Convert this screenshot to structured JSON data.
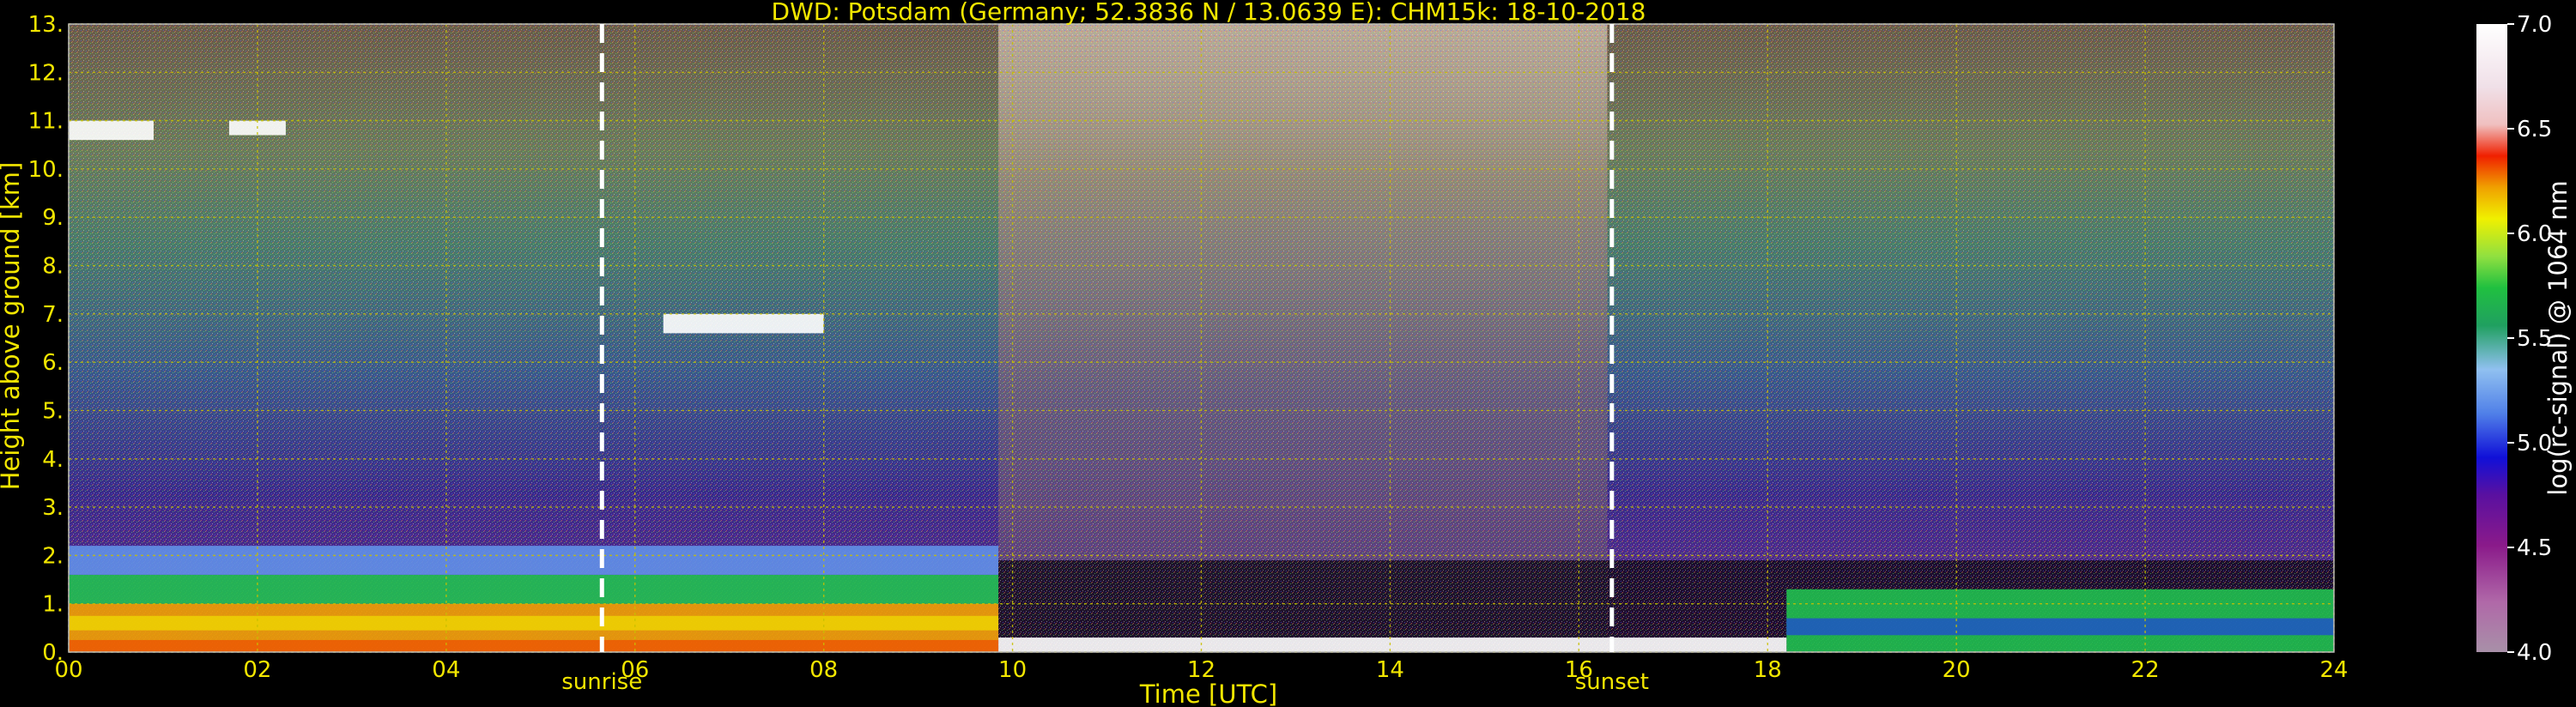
{
  "chart_data": {
    "type": "heatmap",
    "title": "DWD: Potsdam (Germany; 52.3836 N / 13.0639 E):    CHM15k: 18-10-2018",
    "xlabel": "Time [UTC]",
    "ylabel": "Height above ground [km]",
    "xlim": [
      0,
      24
    ],
    "ylim": [
      0,
      13
    ],
    "x_ticks": [
      "00",
      "02",
      "04",
      "06",
      "08",
      "10",
      "12",
      "14",
      "16",
      "18",
      "20",
      "22",
      "24"
    ],
    "y_ticks": [
      "0.",
      "1.",
      "2.",
      "3.",
      "4.",
      "5.",
      "6.",
      "7.",
      "8.",
      "9.",
      "10.",
      "11.",
      "12.",
      "13."
    ],
    "grid": true,
    "markers": [
      {
        "label": "sunrise",
        "x": 5.65
      },
      {
        "label": "sunset",
        "x": 16.35
      }
    ],
    "colorbar": {
      "label": "log(rc-signal) @ 1064 nm",
      "range": [
        4.0,
        7.0
      ],
      "ticks": [
        "4.0",
        "4.5",
        "5.0",
        "5.5",
        "6.0",
        "6.5",
        "7.0"
      ]
    },
    "layers": [
      {
        "name": "boundary-layer-strong",
        "x": [
          0,
          9.85
        ],
        "y": [
          0,
          1.0
        ],
        "level": 6.0
      },
      {
        "name": "boundary-layer-mid",
        "x": [
          0,
          9.85
        ],
        "y": [
          1.0,
          1.6
        ],
        "level": 5.5
      },
      {
        "name": "residual-layer",
        "x": [
          0,
          9.85
        ],
        "y": [
          1.6,
          2.2
        ],
        "level": 5.2
      },
      {
        "name": "cloud-cirrus-1",
        "x": [
          0.0,
          0.9
        ],
        "y": [
          10.6,
          11.0
        ],
        "level": 7.0
      },
      {
        "name": "cloud-cirrus-2",
        "x": [
          1.7,
          2.3
        ],
        "y": [
          10.7,
          11.0
        ],
        "level": 7.0
      },
      {
        "name": "cloud-midlevel",
        "x": [
          6.3,
          8.0
        ],
        "y": [
          6.6,
          7.0
        ],
        "level": 7.0
      },
      {
        "name": "night-boundary-layer",
        "x": [
          18.2,
          24
        ],
        "y": [
          0,
          1.3
        ],
        "level": 5.6
      },
      {
        "name": "daytime-surface-layer",
        "x": [
          9.85,
          18.2
        ],
        "y": [
          0,
          0.3
        ],
        "level": 7.0
      }
    ]
  },
  "colors": {
    "text_axis": "#f2e600",
    "text_colorbar": "#ffffff",
    "grid": "#c8c000",
    "background": "#000000"
  }
}
